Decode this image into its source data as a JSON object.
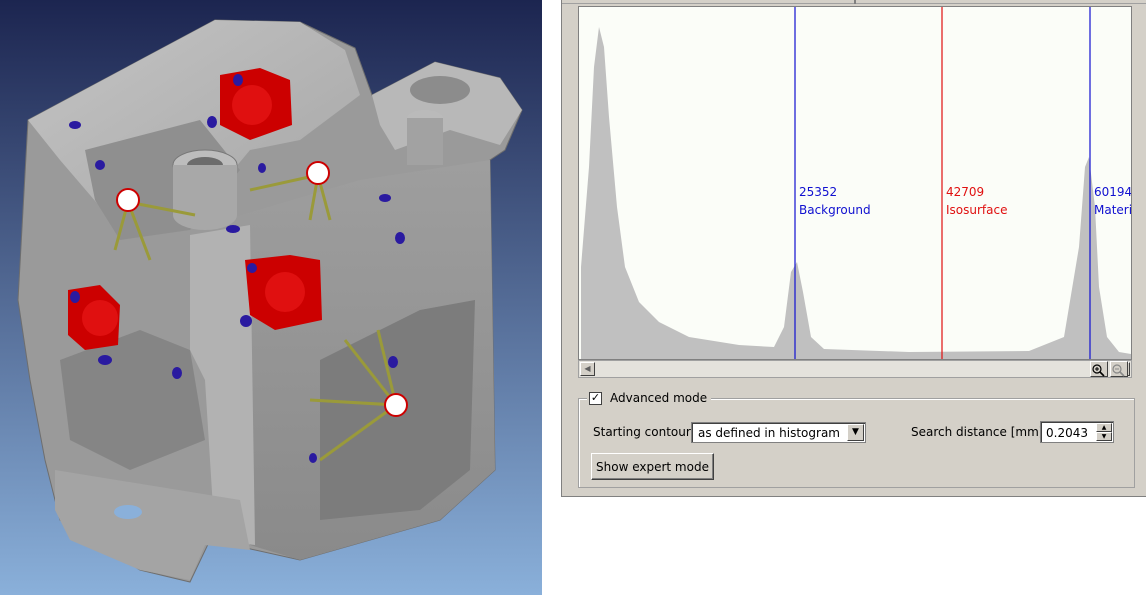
{
  "viewport": {
    "background_top": "#1c2550",
    "background_bottom": "#8ab0da",
    "part_color": "#a8a8a8",
    "marker_red": "#cc0000",
    "marker_blue": "#2a1aa0",
    "probe_line": "#9a9a3a"
  },
  "histogram": {
    "markers": [
      {
        "value": "25352",
        "name": "Background",
        "color": "#1010d0"
      },
      {
        "value": "42709",
        "name": "Isosurface",
        "color": "#e01010"
      },
      {
        "value": "60194",
        "name": "Material",
        "color": "#1010d0"
      }
    ],
    "fill_color": "#c0c0c0",
    "bg_color": "#fbfdf8"
  },
  "controls": {
    "advanced_mode_label": "Advanced mode",
    "advanced_mode_checked": "✓",
    "starting_contour_label": "Starting contour",
    "starting_contour_value": "as defined in histogram",
    "search_distance_label": "Search distance [mm]",
    "search_distance_value": "0.2043",
    "expert_button_label": "Show expert mode"
  }
}
